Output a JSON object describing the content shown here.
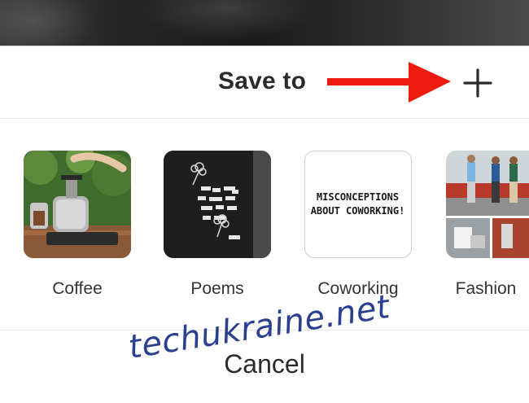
{
  "sheet": {
    "title": "Save to",
    "add_icon": "plus-icon",
    "annotation_icon": "red-arrow-icon",
    "accent_color": "#ee1c0f"
  },
  "boards": [
    {
      "label": "Coffee",
      "icon": "coffee-thumbnail"
    },
    {
      "label": "Poems",
      "icon": "poems-thumbnail"
    },
    {
      "label": "Coworking",
      "icon": "coworking-thumbnail",
      "thumb_text": "MISCONCEPTIONS ABOUT COWORKING!"
    },
    {
      "label": "Fashion",
      "icon": "fashion-thumbnail"
    }
  ],
  "cancel_label": "Cancel",
  "watermark": "techukraine.net"
}
